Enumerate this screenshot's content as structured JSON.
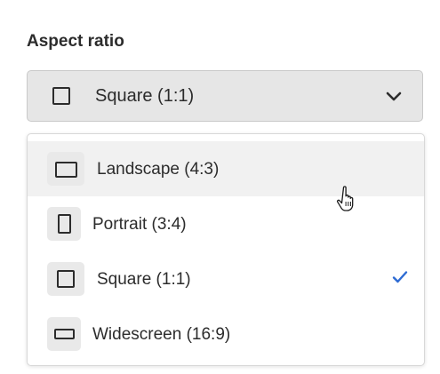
{
  "field": {
    "label": "Aspect ratio"
  },
  "picker": {
    "selected_value": "Square (1:1)",
    "selected_icon": "square-ratio-icon",
    "toggle_icon": "chevron-down-icon"
  },
  "menu": {
    "items": [
      {
        "label": "Landscape (4:3)",
        "icon": "landscape-ratio-icon",
        "selected": false,
        "hovered": true
      },
      {
        "label": "Portrait (3:4)",
        "icon": "portrait-ratio-icon",
        "selected": false,
        "hovered": false
      },
      {
        "label": "Square (1:1)",
        "icon": "square-ratio-icon",
        "selected": true,
        "hovered": false
      },
      {
        "label": "Widescreen (16:9)",
        "icon": "widescreen-ratio-icon",
        "selected": false,
        "hovered": false
      }
    ],
    "check_icon": "checkmark-icon"
  },
  "colors": {
    "accent": "#2d6bd3",
    "picker_background": "#e6e6e6",
    "hover_background": "#f1f1f1",
    "text": "#2c2c2c"
  }
}
